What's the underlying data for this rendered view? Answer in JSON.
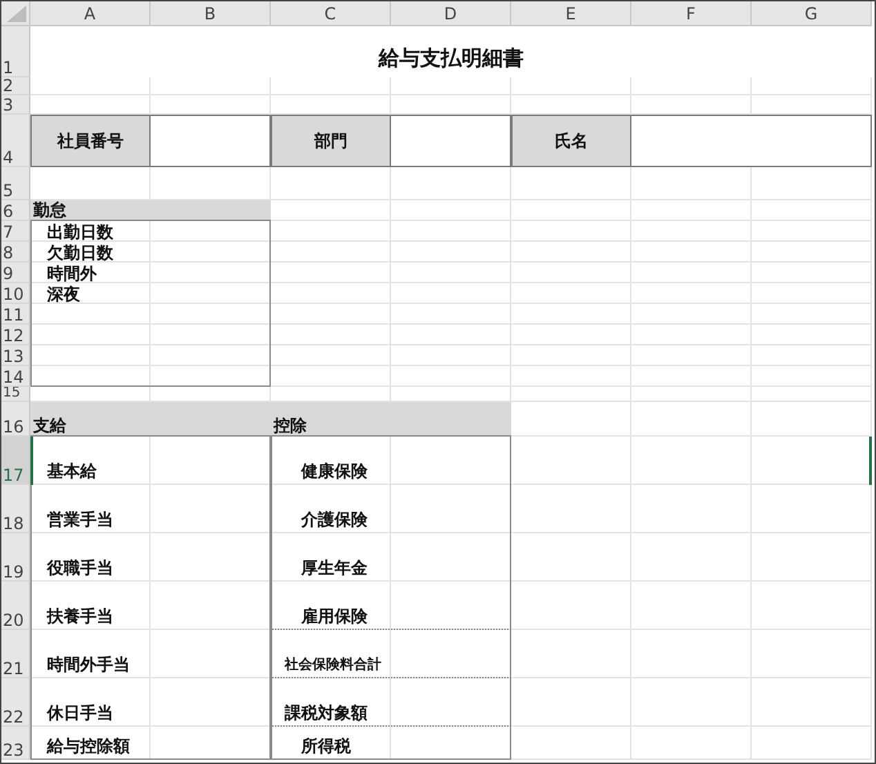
{
  "column_headers": [
    "A",
    "B",
    "C",
    "D",
    "E",
    "F",
    "G"
  ],
  "row_headers": [
    {
      "label": "1",
      "selected": false
    },
    {
      "label": "2",
      "selected": false
    },
    {
      "label": "3",
      "selected": false
    },
    {
      "label": "4",
      "selected": false
    },
    {
      "label": "5",
      "selected": false
    },
    {
      "label": "6",
      "selected": false
    },
    {
      "label": "7",
      "selected": false
    },
    {
      "label": "8",
      "selected": false
    },
    {
      "label": "9",
      "selected": false
    },
    {
      "label": "10",
      "selected": false
    },
    {
      "label": "11",
      "selected": false
    },
    {
      "label": "12",
      "selected": false
    },
    {
      "label": "13",
      "selected": false
    },
    {
      "label": "14",
      "selected": false
    },
    {
      "label": "15",
      "selected": false
    },
    {
      "label": "16",
      "selected": false
    },
    {
      "label": "17",
      "selected": true
    },
    {
      "label": "18",
      "selected": false
    },
    {
      "label": "19",
      "selected": false
    },
    {
      "label": "20",
      "selected": false
    },
    {
      "label": "21",
      "selected": false
    },
    {
      "label": "22",
      "selected": false
    },
    {
      "label": "23",
      "selected": false
    }
  ],
  "title": "給与支払明細書",
  "info_fields": [
    {
      "label": "社員番号"
    },
    {
      "label": "部門"
    },
    {
      "label": "氏名"
    }
  ],
  "attendance": {
    "heading": "勤怠",
    "items": [
      "出勤日数",
      "欠勤日数",
      "時間外",
      "深夜"
    ]
  },
  "payments": {
    "heading": "支給",
    "items": [
      "基本給",
      "営業手当",
      "役職手当",
      "扶養手当",
      "時間外手当",
      "休日手当",
      "給与控除額"
    ]
  },
  "deductions": {
    "heading": "控除",
    "items": [
      {
        "label": "健康保険",
        "kind": "item"
      },
      {
        "label": "介護保険",
        "kind": "item"
      },
      {
        "label": "厚生年金",
        "kind": "item"
      },
      {
        "label": "雇用保険",
        "kind": "item"
      },
      {
        "label": "社会保険料合計",
        "kind": "subtotal"
      },
      {
        "label": "課税対象額",
        "kind": "total"
      },
      {
        "label": "所得税",
        "kind": "item"
      }
    ]
  }
}
